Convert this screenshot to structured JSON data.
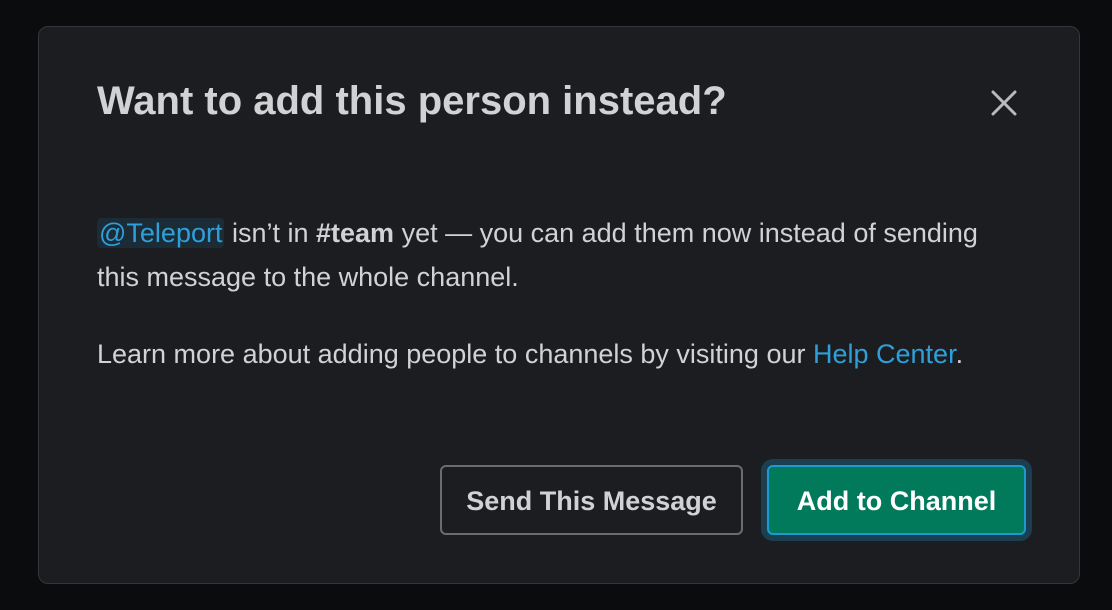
{
  "dialog": {
    "title": "Want to add this person instead?",
    "close_icon": "close-icon",
    "message": {
      "mention": "@Teleport",
      "text_before_channel": " isn’t in ",
      "channel": "#team",
      "text_after_channel": " yet — you can add them now instead of sending this message to the whole channel."
    },
    "help": {
      "text_before_link": "Learn more about adding people to channels by visiting our ",
      "link_text": "Help Center",
      "text_after_link": "."
    },
    "buttons": {
      "secondary_label": "Send This Message",
      "primary_label": "Add to Channel"
    }
  },
  "colors": {
    "background": "#0b0c0e",
    "modal_background": "#1b1d21",
    "text": "#d1d2d3",
    "link": "#2f9fd9",
    "primary_button": "#007a5a",
    "focus_ring": "#1d9bd1"
  }
}
